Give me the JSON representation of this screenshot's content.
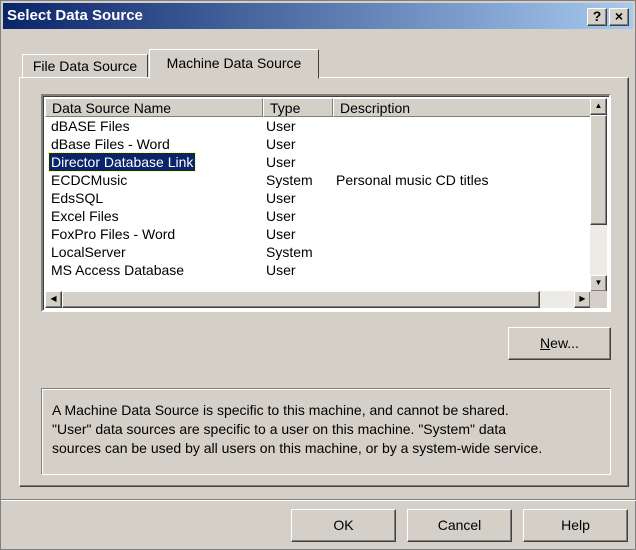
{
  "window": {
    "title": "Select Data Source",
    "help_button": "?",
    "close_button": "×"
  },
  "tabs": [
    {
      "label": "File Data Source",
      "active": false
    },
    {
      "label": "Machine Data Source",
      "active": true
    }
  ],
  "list": {
    "columns": [
      "Data Source Name",
      "Type",
      "Description"
    ],
    "rows": [
      {
        "name": "dBASE Files",
        "type": "User",
        "description": ""
      },
      {
        "name": "dBase Files - Word",
        "type": "User",
        "description": ""
      },
      {
        "name": "Director Database Link",
        "type": "User",
        "description": "",
        "selected": true
      },
      {
        "name": "ECDCMusic",
        "type": "System",
        "description": "Personal music CD titles"
      },
      {
        "name": "EdsSQL",
        "type": "User",
        "description": ""
      },
      {
        "name": "Excel Files",
        "type": "User",
        "description": ""
      },
      {
        "name": "FoxPro Files - Word",
        "type": "User",
        "description": ""
      },
      {
        "name": "LocalServer",
        "type": "System",
        "description": ""
      },
      {
        "name": "MS Access Database",
        "type": "User",
        "description": ""
      }
    ]
  },
  "buttons": {
    "new_prefix": "",
    "new_underline": "N",
    "new_suffix": "ew...",
    "ok": "OK",
    "cancel": "Cancel",
    "help": "Help"
  },
  "description": {
    "lines": [
      "A Machine Data Source is specific to this machine, and cannot be shared.",
      "\"User\" data sources are specific to a user on this machine.  \"System\" data",
      "sources can be used by all users on this machine, or by a system-wide service."
    ]
  },
  "colors": {
    "face": "#d4d0c8",
    "title_start": "#0a246a",
    "title_end": "#a6caf0",
    "selection": "#0a246a"
  }
}
